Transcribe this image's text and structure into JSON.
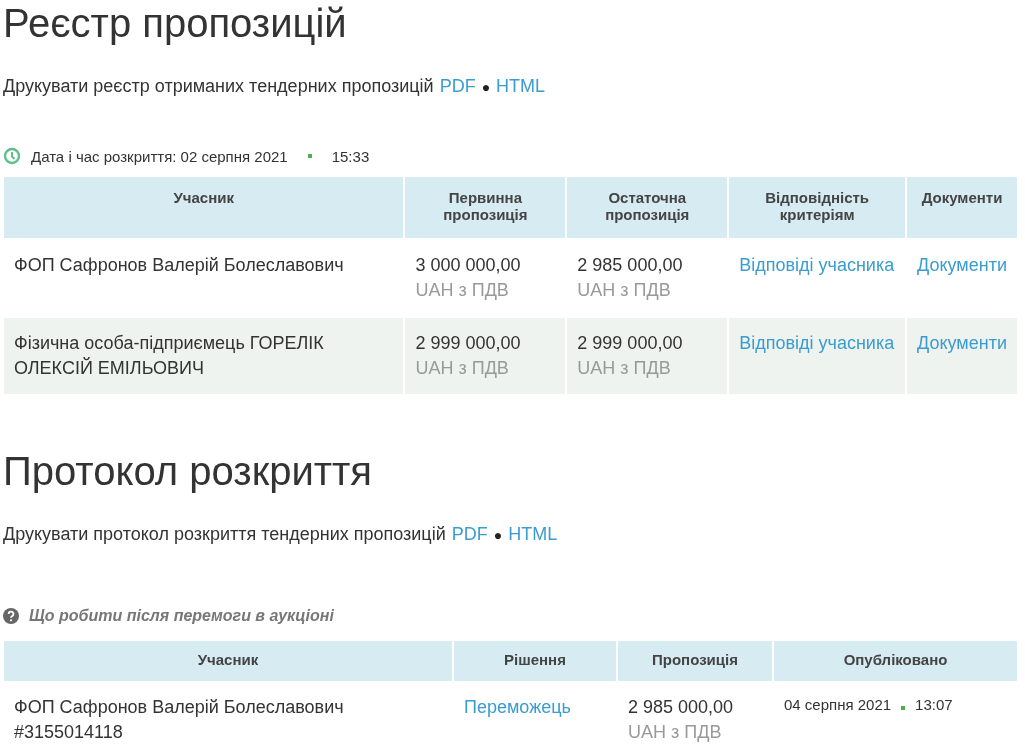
{
  "registry": {
    "title": "Реєстр пропозицій",
    "print_text": "Друкувати реєстр отриманих тендерних пропозицій",
    "print_links": [
      {
        "label": "PDF"
      },
      {
        "label": "HTML"
      }
    ],
    "separator": "●",
    "opening": {
      "label": "Дата і час розкриття: 02 серпня 2021",
      "time": "15:33"
    },
    "table": {
      "columns": [
        "Учасник",
        "Первинна пропозиція",
        "Остаточна пропозиція",
        "Відповідність критеріям",
        "Документи"
      ],
      "rows": [
        {
          "participant": "ФОП Сафронов Валерій Болеславович",
          "initial": "3 000 000,00",
          "initial_currency": "UAH з ПДВ",
          "final": "2 985 000,00",
          "final_currency": "UAH з ПДВ",
          "criteria_link": "Відповіді учасника",
          "documents_link": "Документи"
        },
        {
          "participant": "Фізична особа-підприємець ГОРЕЛІК ОЛЕКСІЙ ЕМІЛЬОВИЧ",
          "initial": "2 999 000,00",
          "initial_currency": "UAH з ПДВ",
          "final": "2 999 000,00",
          "final_currency": "UAH з ПДВ",
          "criteria_link": "Відповіді учасника",
          "documents_link": "Документи"
        }
      ]
    }
  },
  "protocol": {
    "title": "Протокол розкриття",
    "print_text": "Друкувати протокол розкриття тендерних пропозицій",
    "print_links": [
      {
        "label": "PDF"
      },
      {
        "label": "HTML"
      }
    ],
    "separator": "●",
    "help_link": "Що робити після перемоги в аукціоні",
    "table": {
      "columns": [
        "Учасник",
        "Рішення",
        "Пропозиція",
        "Опубліковано"
      ],
      "rows": [
        {
          "participant": "ФОП Сафронов Валерій Болеславович",
          "participant_id": "#3155014118",
          "decision": "Переможець",
          "amount": "2 985 000,00",
          "currency": "UAH з ПДВ",
          "published_date": "04 серпня 2021",
          "published_time": "13:07"
        }
      ]
    }
  }
}
